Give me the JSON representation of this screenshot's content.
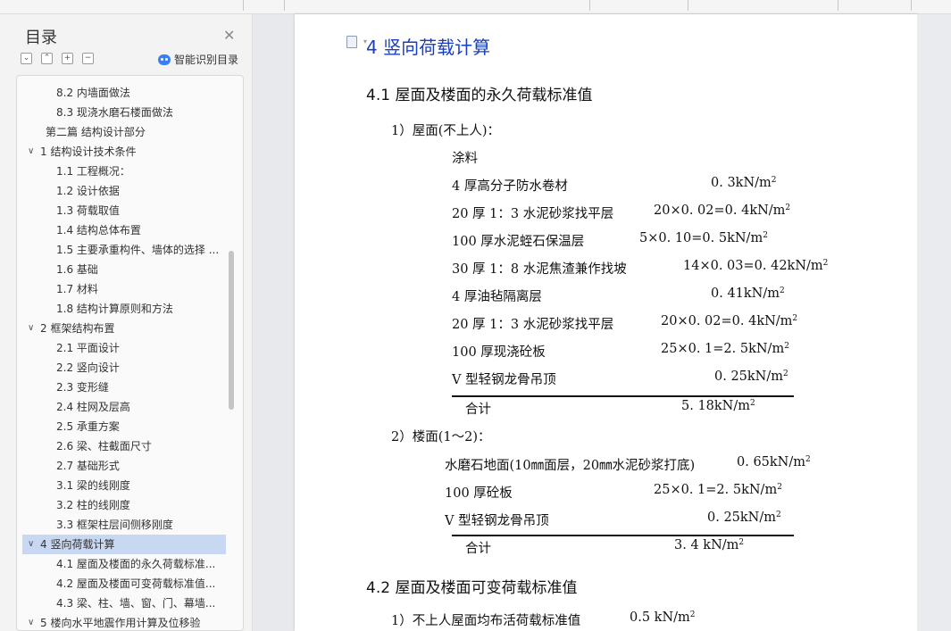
{
  "sidebar": {
    "title": "目录",
    "smart_toc_label": "智能识别目录",
    "toc": [
      {
        "label": "8.2 内墙面做法",
        "level": 2
      },
      {
        "label": "8.3 现浇水磨石楼面做法",
        "level": 2
      },
      {
        "label": "第二篇  结构设计部分",
        "level": 1
      },
      {
        "label": "1  结构设计技术条件",
        "level": 0,
        "expanded": true
      },
      {
        "label": "1.1 工程概况：",
        "level": 2
      },
      {
        "label": "1.2  设计依据",
        "level": 2
      },
      {
        "label": "1.3  荷载取值",
        "level": 2
      },
      {
        "label": "1.4  结构总体布置",
        "level": 2
      },
      {
        "label": "1.5  主要承重构件、墙体的选择 ...",
        "level": 2
      },
      {
        "label": "1.6  基础",
        "level": 2
      },
      {
        "label": "1.7  材料",
        "level": 2
      },
      {
        "label": "1.8  结构计算原则和方法",
        "level": 2
      },
      {
        "label": "2  框架结构布置",
        "level": 0,
        "expanded": true
      },
      {
        "label": "2.1  平面设计",
        "level": 2
      },
      {
        "label": "2.2  竖向设计",
        "level": 2
      },
      {
        "label": "2.3  变形缝",
        "level": 2
      },
      {
        "label": "2.4  柱网及层高",
        "level": 2
      },
      {
        "label": "2.5  承重方案",
        "level": 2
      },
      {
        "label": "2.6  梁、柱截面尺寸",
        "level": 2
      },
      {
        "label": "2.7  基础形式",
        "level": 2
      },
      {
        "label": "3.1  梁的线刚度",
        "level": 2
      },
      {
        "label": "3.2  柱的线刚度",
        "level": 2
      },
      {
        "label": "3.3  框架柱层间侧移刚度",
        "level": 2
      },
      {
        "label": "4  竖向荷载计算",
        "level": 0,
        "expanded": true,
        "selected": true
      },
      {
        "label": "4.1  屋面及楼面的永久荷载标准...",
        "level": 2
      },
      {
        "label": "4.2  屋面及楼面可变荷载标准值...",
        "level": 2
      },
      {
        "label": "4.3  梁、柱、墙、窗、门、幕墙...",
        "level": 2
      },
      {
        "label": "5  楼向水平地震作用计算及位移验",
        "level": 0
      }
    ]
  },
  "doc": {
    "title": "4  竖向荷载计算",
    "sec41": "4.1  屋面及楼面的永久荷载标准值",
    "roof_heading": "1）屋面(不上人)：",
    "roof_rows": [
      {
        "name": "涂料",
        "value": ""
      },
      {
        "name": "4 厚高分子防水卷材",
        "value": "0. 3kN/m"
      },
      {
        "name": "20 厚 1：3 水泥砂浆找平层",
        "value": "20×0. 02=0. 4kN/m"
      },
      {
        "name": "100 厚水泥蛭石保温层",
        "value": "5×0. 10=0. 5kN/m"
      },
      {
        "name": "30 厚 1：8 水泥焦渣兼作找坡",
        "value": "14×0. 03=0. 42kN/m"
      },
      {
        "name": "4 厚油毡隔离层",
        "value": "0. 41kN/m"
      },
      {
        "name": "20 厚 1：3 水泥砂浆找平层",
        "value": "20×0. 02=0. 4kN/m"
      },
      {
        "name": "100 厚现浇砼板",
        "value": "25×0. 1=2. 5kN/m"
      },
      {
        "name": "V 型轻钢龙骨吊顶",
        "value": "0. 25kN/m"
      }
    ],
    "roof_total_label": "合计",
    "roof_total_value": "5. 18kN/m",
    "floor_heading": "2）楼面(1～2)：",
    "floor_rows": [
      {
        "name": "水磨石地面(10㎜面层，20㎜水泥砂浆打底)",
        "value": "0. 65kN/m"
      },
      {
        "name": "100 厚砼板",
        "value": "25×0. 1=2. 5kN/m"
      },
      {
        "name": "V 型轻钢龙骨吊顶",
        "value": "0. 25kN/m"
      }
    ],
    "floor_total_label": "合计",
    "floor_total_value": "3. 4 kN/m",
    "sec42": "4.2  屋面及楼面可变荷载标准值",
    "live_row": "1）不上人屋面均布活荷载标准值",
    "live_value": "0.5 kN/m",
    "sup": "2"
  }
}
